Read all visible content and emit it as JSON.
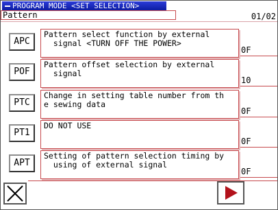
{
  "header": {
    "title": "PROGRAM MODE <SET SELECTION>",
    "section_label": "Pattern",
    "page": "01/02"
  },
  "rows": [
    {
      "code": "APC",
      "description": "Pattern select function by external\n  signal <TURN OFF THE POWER>",
      "value": "0F"
    },
    {
      "code": "POF",
      "description": "Pattern offset selection by external\n  signal",
      "value": "10"
    },
    {
      "code": "PTC",
      "description": "Change in setting table number from th\ne sewing data",
      "value": "0F"
    },
    {
      "code": "PT1",
      "description": "DO NOT USE",
      "value": "0F"
    },
    {
      "code": "APT",
      "description": "Setting of pattern selection timing by\n  using of external signal",
      "value": "0F"
    }
  ],
  "footer": {
    "close_icon": "close-icon",
    "next_icon": "play-arrow-icon",
    "accent_color": "#b3121b"
  }
}
